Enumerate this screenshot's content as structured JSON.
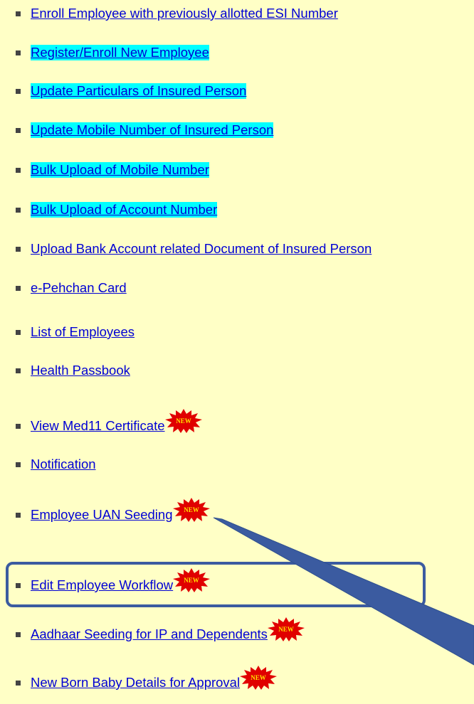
{
  "menu": {
    "items": [
      {
        "label": "Enroll Employee with previously allotted ESI Number",
        "highlighted": false,
        "new": false
      },
      {
        "label": "Register/Enroll New Employee",
        "highlighted": true,
        "new": false
      },
      {
        "label": "Update Particulars of Insured Person",
        "highlighted": true,
        "new": false
      },
      {
        "label": "Update Mobile Number of Insured Person",
        "highlighted": true,
        "new": false
      },
      {
        "label": "Bulk Upload of Mobile Number",
        "highlighted": true,
        "new": false
      },
      {
        "label": "Bulk Upload of Account Number",
        "highlighted": true,
        "new": false
      },
      {
        "label": "Upload Bank Account related Document of Insured Person",
        "highlighted": false,
        "new": false
      },
      {
        "label": "e-Pehchan Card",
        "highlighted": false,
        "new": false
      },
      {
        "label": "List of Employees",
        "highlighted": false,
        "new": false
      },
      {
        "label": "Health Passbook",
        "highlighted": false,
        "new": false
      },
      {
        "label": "View Med11 Certificate",
        "highlighted": false,
        "new": true
      },
      {
        "label": "Notification",
        "highlighted": false,
        "new": false
      },
      {
        "label": "Employee UAN Seeding",
        "highlighted": false,
        "new": true
      },
      {
        "label": "Edit Employee Workflow",
        "highlighted": false,
        "new": true
      },
      {
        "label": "Aadhaar Seeding for IP and Dependents",
        "highlighted": false,
        "new": true
      },
      {
        "label": "New Born Baby Details for Approval",
        "highlighted": false,
        "new": true
      }
    ],
    "new_badge_text": "NEW"
  },
  "colors": {
    "background": "#FFFFC6",
    "link": "#0000D4",
    "highlight": "#00FFFF",
    "annotation": "#3B5BA0"
  }
}
